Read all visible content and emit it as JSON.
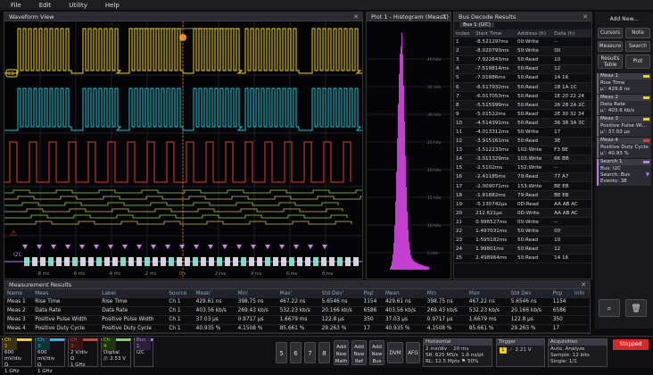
{
  "menu": [
    "File",
    "Edit",
    "Utility",
    "Help"
  ],
  "waveform": {
    "title": "Waveform View",
    "ch1_label": "C1",
    "ch1_scale": [
      "1 V",
      "800 mV",
      "600 mV",
      "400 mV",
      "200 mV",
      "0 V"
    ],
    "ch2_scale": [
      "8 V",
      "7 V",
      "6 V",
      "5 V",
      "4 V",
      "3 V"
    ],
    "bus_label": "I2C",
    "time_ticks": [
      "-8 ms",
      "-6 ms",
      "-4 ms",
      "-2 ms",
      "0 s",
      "2 ms",
      "4 ms",
      "6 ms",
      "8 ms"
    ],
    "trigger_marker": "T",
    "colors": {
      "ch1": "#f2d20c",
      "ch2": "#19c6d6",
      "ch3": "#e23a3a",
      "ch4": "#8fd14f",
      "bus": "#b57ee6"
    }
  },
  "histogram": {
    "title": "Plot 1 - Histogram (Meas1)",
    "y_ticks": [
      "40 hits",
      "35 hits",
      "30 hits",
      "25 hits",
      "20 hits",
      "15 hits",
      "10 hits",
      "5 hits"
    ]
  },
  "bus_decode": {
    "title": "Bus Decode Results",
    "tab": "Bus 1 (I2C)",
    "columns": [
      "Index",
      "Start Time",
      "Address (h)",
      "Data (h)"
    ],
    "rows": [
      [
        "1",
        "-8.52129?ms",
        "00:Write",
        "--"
      ],
      [
        "2",
        "-8.020793ms",
        "50:Write",
        "00"
      ],
      [
        "3",
        "-7.922643ms",
        "50:Read",
        "10"
      ],
      [
        "4",
        "-7.519814ms",
        "50:Read",
        "12"
      ],
      [
        "5",
        "-7.01886ms",
        "50:Read",
        "14 16"
      ],
      [
        "6",
        "-6.517932ms",
        "50:Read",
        "18 1A 1C"
      ],
      [
        "7",
        "-6.017053ms",
        "50:Read",
        "1E 20 22 24"
      ],
      [
        "8",
        "-5.515999ms",
        "50:Read",
        "26 28 2A 2C"
      ],
      [
        "9",
        "-5.01522ms",
        "50:Read",
        "2E 30 32 34"
      ],
      [
        "10",
        "-4.514391ms",
        "50:Read",
        "36 38 3A 3C"
      ],
      [
        "11",
        "-4.013312ms",
        "50:Write",
        "17"
      ],
      [
        "12",
        "-3.915161ms",
        "50:Read",
        "3E"
      ],
      [
        "13",
        "-3.512233ms",
        "102:Write",
        "F3 8E"
      ],
      [
        "14",
        "-3.011329ms",
        "103:Write",
        "66 BB"
      ],
      [
        "15",
        "-2.5102ms",
        "152:Write",
        "--"
      ],
      [
        "16",
        "-2.41185ms",
        "79:Read",
        "77 A7"
      ],
      [
        "17",
        "-2.009071ms",
        "153:Write",
        "BE EB"
      ],
      [
        "18",
        "-1.81882ms",
        "79:Read",
        "BE EB"
      ],
      [
        "19",
        "-5.130742µs",
        "0D:Read",
        "AA AB AC"
      ],
      [
        "20",
        "212.621µs",
        "0D:Write",
        "AA AB AC"
      ],
      [
        "21",
        "0.996527ms",
        "00:Write",
        "--"
      ],
      [
        "22",
        "1.497031ms",
        "50:Write",
        "00"
      ],
      [
        "23",
        "1.595182ms",
        "50:Read",
        "10"
      ],
      [
        "24",
        "1.99801ms",
        "50:Read",
        "12"
      ],
      [
        "25",
        "2.498964ms",
        "50:Read",
        "14 16"
      ]
    ]
  },
  "right_panel": {
    "add_new": "Add New...",
    "buttons": [
      "Cursors",
      "Note",
      "Measure",
      "Search",
      "Results Table",
      "Plot"
    ],
    "badges": [
      {
        "title": "Meas 1",
        "line1": "Rise Time",
        "line2": "µ': 429.6 ns",
        "color": "#f2d20c"
      },
      {
        "title": "Meas 2",
        "line1": "Data Rate",
        "line2": "µ': 403.6 kb/s",
        "color": "#f2d20c"
      },
      {
        "title": "Meas 3",
        "line1": "Positive Pulse Wi...",
        "line2": "µ': 37.03 µs",
        "color": "#f2d20c"
      },
      {
        "title": "Meas 4",
        "line1": "Positive Duty Cycle",
        "line2": "µ': 40.93 %",
        "color": "#f2d20c"
      },
      {
        "title": "Search 1",
        "line1": "Bus: I2C",
        "line2": "Search: Bus",
        "line3": "Events: 38",
        "color": "#b57ee6"
      }
    ]
  },
  "measurements": {
    "title": "Measurement Results",
    "columns": [
      "Name",
      "Meas",
      "Label",
      "Source",
      "Mean'",
      "Min'",
      "Max'",
      "Std Dev'",
      "Pop'",
      "Mean",
      "Min",
      "Max",
      "Std Dev",
      "Pop",
      "Info"
    ],
    "rows": [
      [
        "Meas 1",
        "Rise Time",
        "Rise Time",
        "Ch 1",
        "429.61 ns",
        "398.75 ns",
        "467.22 ns",
        "5.6546 ns",
        "1154",
        "429.61 ns",
        "398.75 ns",
        "467.22 ns",
        "5.6546 ns",
        "1154",
        ""
      ],
      [
        "Meas 2",
        "Data Rate",
        "Data Rate",
        "Ch 1",
        "403.56 kb/s",
        "269.43 kb/s",
        "532.23 kb/s",
        "20.166 kb/s",
        "6586",
        "403.56 kb/s",
        "269.43 kb/s",
        "532.23 kb/s",
        "20.166 kb/s",
        "6586",
        ""
      ],
      [
        "Meas 3",
        "Positive Pulse Width",
        "Positive Pulse Width",
        "Ch 1",
        "37.03 µs",
        "0.9717 µs",
        "1.6679 ms",
        "122.8 µs",
        "350",
        "37.03 µs",
        "0.9717 µs",
        "1.6679 ms",
        "122.8 µs",
        "350",
        ""
      ],
      [
        "Meas 4",
        "Positive Duty Cycle",
        "Positive Duty Cycle",
        "Ch 1",
        "40.935 %",
        "4.1508 %",
        "85.661 %",
        "29.263 %",
        "17",
        "40.935 %",
        "4.1508 %",
        "85.661 %",
        "29.263 %",
        "17",
        ""
      ]
    ]
  },
  "bottom": {
    "ch1": {
      "name": "Ch 1",
      "l1": "600 mV/div",
      "l2": "Ω",
      "l3": "1 GHz"
    },
    "ch2": {
      "name": "Ch 2",
      "l1": "600 mV/div",
      "l2": "Ω",
      "l3": "1 GHz"
    },
    "ch3": {
      "name": "Ch 3",
      "l1": "2 V/div",
      "l2": "Ω",
      "l3": "1 GHz"
    },
    "ch4": {
      "name": "Ch 4",
      "l1": "Digital",
      "l2": "∕∕: 2.53 V",
      "l3": ""
    },
    "bus1": {
      "name": "Bus 1",
      "l1": "I2C"
    },
    "num_buttons": [
      "5",
      "6",
      "7",
      "8"
    ],
    "add_buttons": [
      "Add New Math",
      "Add New Ref",
      "Add New Bus"
    ],
    "dvm": "DVM",
    "afg": "AFG",
    "horizontal": {
      "title": "Horizontal",
      "l1": "2 ms/div",
      "l1b": "20 ms",
      "l2": "SR: 625 MS/s",
      "l2b": "1.6 ns/pt",
      "l3": "RL: 12.5 Mpts",
      "l3b": "50%"
    },
    "trigger": {
      "title": "Trigger",
      "ch": "1",
      "level": "2.21 V"
    },
    "acquisition": {
      "title": "Acquisition",
      "l1": "Auto,",
      "l1b": "Analyze",
      "l2": "Sample: 12 bits",
      "l3": "Single: 1/1"
    },
    "stopped": "Stopped"
  }
}
